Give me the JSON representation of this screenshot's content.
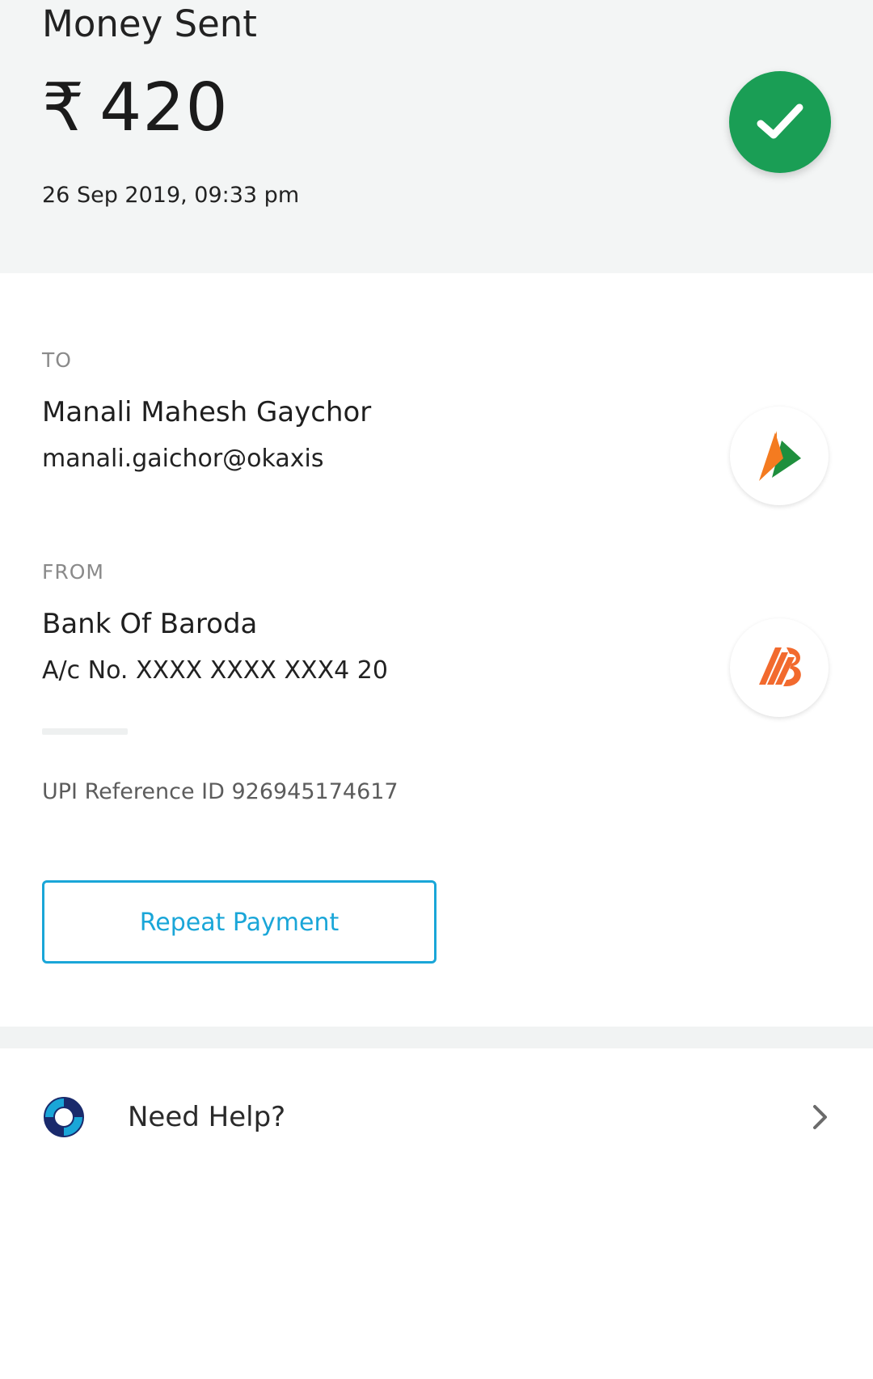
{
  "header": {
    "title": "Money Sent",
    "currency_symbol": "₹",
    "amount": "420",
    "datetime": "26 Sep 2019, 09:33 pm",
    "status_icon": "check-icon",
    "status_color": "#1a9e55"
  },
  "to": {
    "label": "TO",
    "name": "Manali Mahesh Gaychor",
    "upi_id": "manali.gaichor@okaxis",
    "logo": "bhim-upi-logo"
  },
  "from": {
    "label": "FROM",
    "bank": "Bank Of Baroda",
    "account": "A/c No. XXXX XXXX XXX4 20",
    "logo": "bank-of-baroda-logo"
  },
  "upi_reference": "UPI Reference ID 926945174617",
  "actions": {
    "repeat_label": "Repeat Payment",
    "accent_color": "#1aa6d8"
  },
  "help": {
    "label": "Need Help?",
    "icon": "lifebuoy-icon",
    "chevron": "chevron-right-icon"
  }
}
